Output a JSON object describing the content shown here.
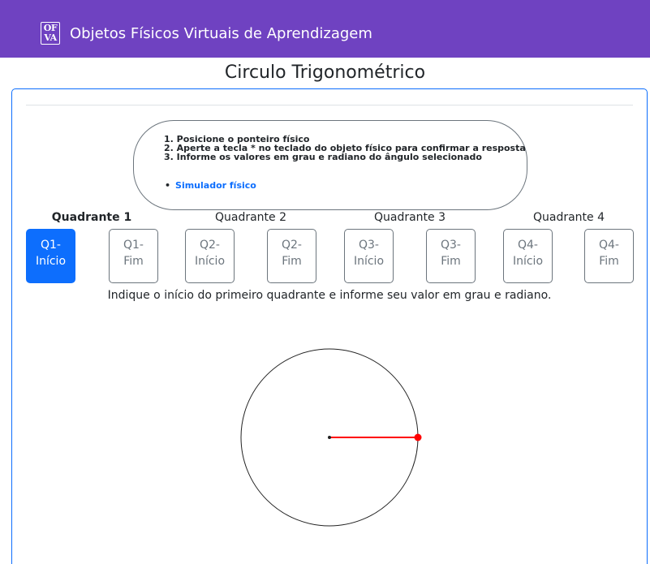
{
  "navbar": {
    "logo_text": "OF VA",
    "brand": "Objetos Físicos Virtuais de Aprendizagem"
  },
  "page_title": "Circulo Trigonométrico",
  "instructions": {
    "lines": [
      "1. Posicione o ponteiro físico",
      "2. Aperte a tecla * no teclado do objeto físico para confirmar a resposta",
      "3. Informe os valores em grau e radiano do ângulo selecionado"
    ],
    "link": "Simulador físico"
  },
  "quadrants": [
    {
      "label": "Quadrante 1",
      "active": true
    },
    {
      "label": "Quadrante 2",
      "active": false
    },
    {
      "label": "Quadrante 3",
      "active": false
    },
    {
      "label": "Quadrante 4",
      "active": false
    }
  ],
  "buttons": [
    {
      "line1": "Q1-",
      "line2": "Início",
      "active": true
    },
    {
      "line1": "Q1-",
      "line2": "Fim",
      "active": false
    },
    {
      "line1": "Q2-",
      "line2": "Início",
      "active": false
    },
    {
      "line1": "Q2-",
      "line2": "Fim",
      "active": false
    },
    {
      "line1": "Q3-",
      "line2": "Início",
      "active": false
    },
    {
      "line1": "Q3-",
      "line2": "Fim",
      "active": false
    },
    {
      "line1": "Q4-",
      "line2": "Início",
      "active": false
    },
    {
      "line1": "Q4-",
      "line2": "Fim",
      "active": false
    }
  ],
  "prompt": "Indique o início do primeiro quadrante e informe seu valor em grau e radiano.",
  "pointer_angle_deg": 0,
  "colors": {
    "navbar": "#6f42c1",
    "primary": "#0d6efd",
    "pointer": "#ff0000"
  }
}
